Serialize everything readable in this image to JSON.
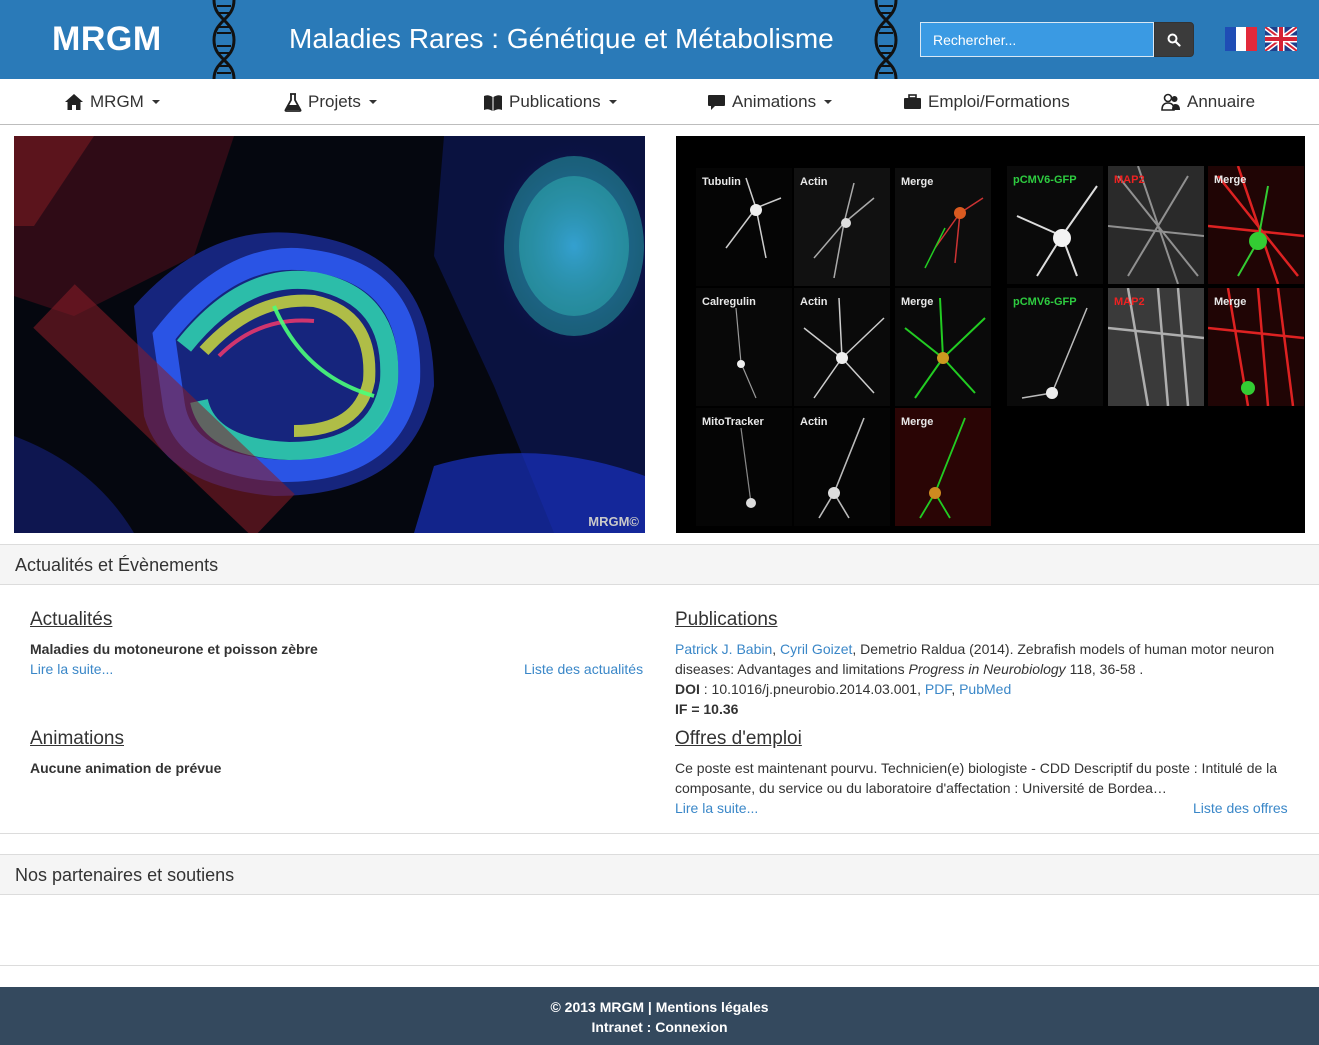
{
  "header": {
    "brand": "MRGM",
    "title": "Maladies Rares : Génétique et Métabolisme",
    "search_placeholder": "Rechercher..."
  },
  "nav": {
    "items": [
      {
        "label": "MRGM",
        "icon": "home-icon",
        "dropdown": true
      },
      {
        "label": "Projets",
        "icon": "flask-icon",
        "dropdown": true
      },
      {
        "label": "Publications",
        "icon": "book-icon",
        "dropdown": true
      },
      {
        "label": "Animations",
        "icon": "comment-icon",
        "dropdown": true
      },
      {
        "label": "Emploi/Formations",
        "icon": "briefcase-icon",
        "dropdown": false
      },
      {
        "label": "Annuaire",
        "icon": "users-icon",
        "dropdown": false
      }
    ]
  },
  "hero": {
    "left_watermark": "MRGM©",
    "right_labels": [
      "Tubulin",
      "Actin",
      "Merge",
      "pCMV6-GFP",
      "MAP2",
      "Merge",
      "Calregulin",
      "Actin",
      "Merge",
      "pCMV6-GFP",
      "MAP2",
      "Merge",
      "MitoTracker",
      "Actin",
      "Merge"
    ]
  },
  "news_panel": {
    "heading": "Actualités et Évènements",
    "actualites": {
      "title": "Actualités",
      "item_title": "Maladies du motoneurone et poisson zèbre",
      "read_more": "Lire la suite...",
      "list_link": "Liste des actualités"
    },
    "publications": {
      "title": "Publications",
      "author1": "Patrick J. Babin",
      "sep1": ",",
      "author2": "Cyril Goizet",
      "citation_rest": ", Demetrio Raldua (2014). Zebrafish models of human motor neuron",
      "citation_line2_a": "diseases: Advantages and limitations ",
      "journal": "Progress in Neurobiology",
      "citation_line2_b": " 118, 36-58 .",
      "doi_label": "DOI",
      "doi_value": " : 10.1016/j.pneurobio.2014.03.001, ",
      "pdf_link": "PDF",
      "sep2": ", ",
      "pubmed_link": "PubMed",
      "if_text": "IF = 10.36"
    },
    "animations": {
      "title": "Animations",
      "item_text": "Aucune animation de prévue"
    },
    "offres": {
      "title": "Offres d'emploi",
      "line1": "Ce poste est maintenant pourvu. Technicien(e) biologiste - CDD Descriptif du poste : Intitulé de la",
      "line2": "composante, du service ou du laboratoire d'affectation : Université de Bordea…",
      "read_more": "Lire la suite...",
      "list_link": "Liste des offres"
    }
  },
  "partners_panel": {
    "heading": "Nos partenaires et soutiens"
  },
  "footer": {
    "copyright": "© 2013 MRGM | ",
    "legal_link": "Mentions légales",
    "intranet_label": "Intranet : ",
    "login_link": "Connexion"
  },
  "colors": {
    "header_bg": "#2a7ab8",
    "link": "#3a87c8",
    "footer_bg": "#34495e"
  }
}
